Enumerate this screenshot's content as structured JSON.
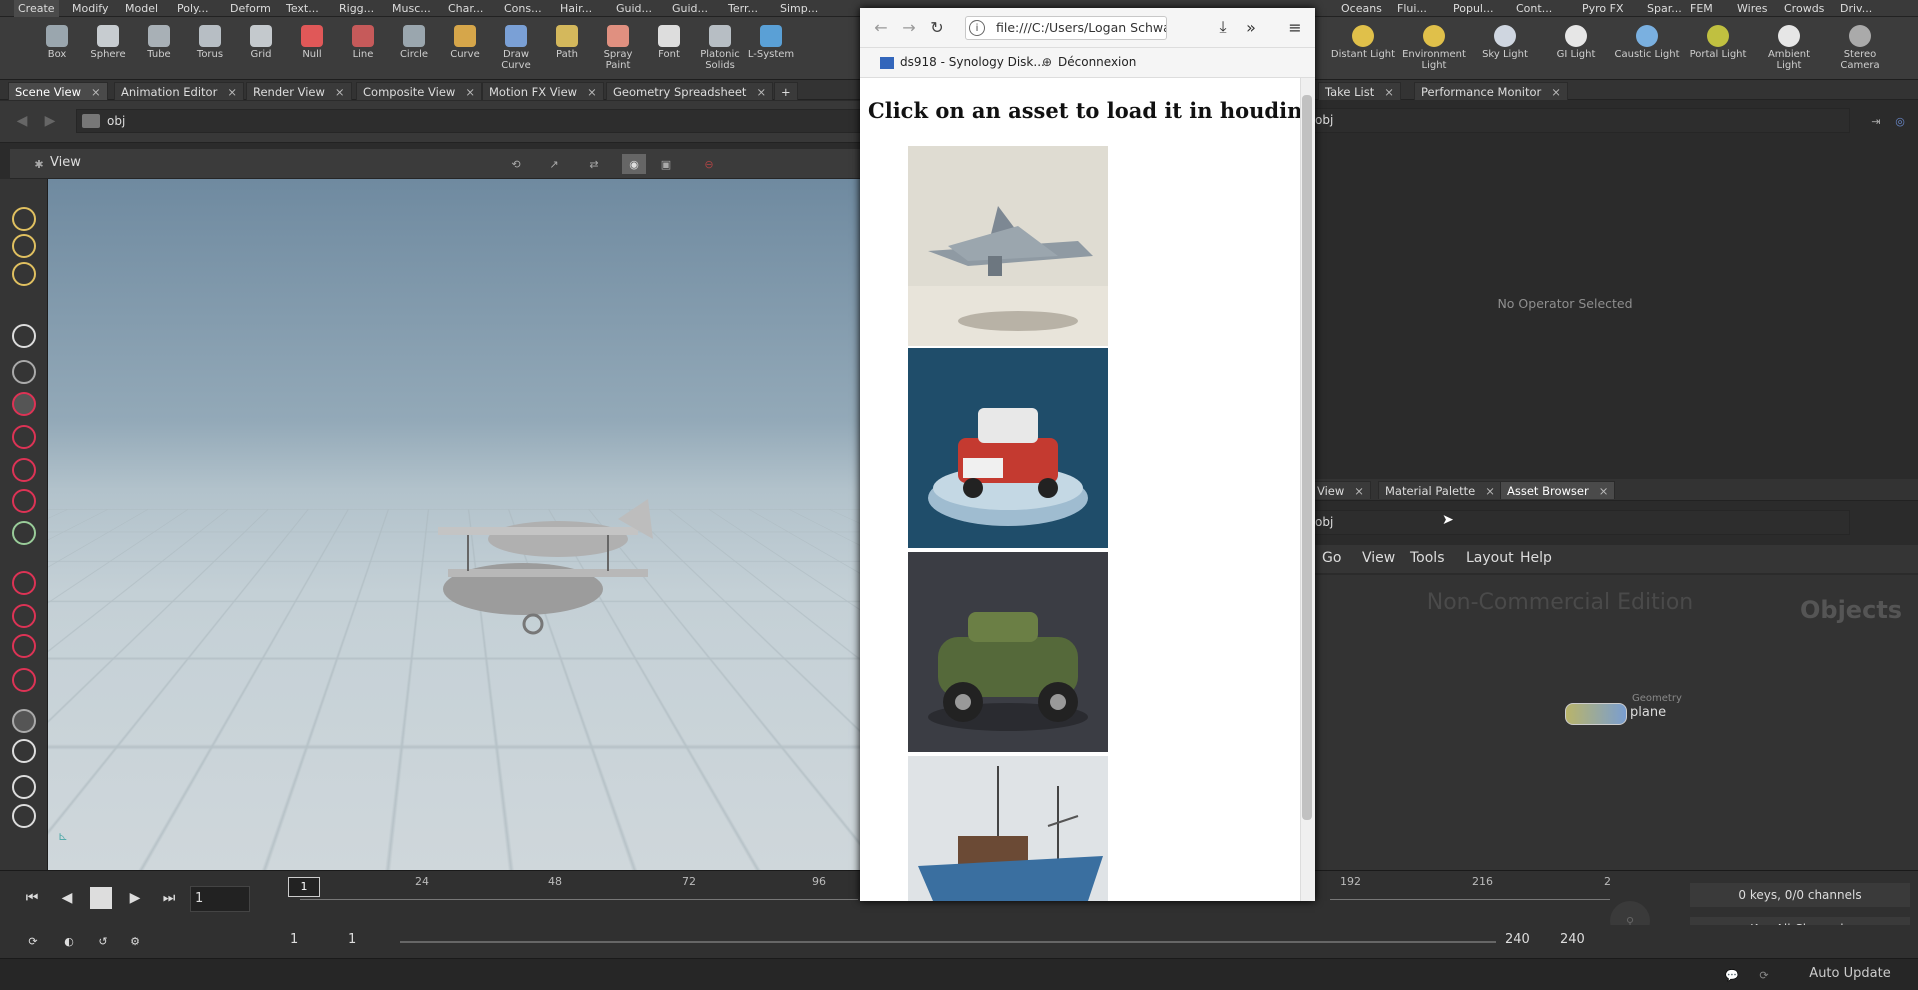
{
  "shelf_tabs": [
    "Create",
    "Modify",
    "Model",
    "Poly...",
    "Deform",
    "Text...",
    "Rigg...",
    "Musc...",
    "Char...",
    "Cons...",
    "Hair...",
    "Guid...",
    "Guid...",
    "Terr...",
    "Simp...",
    "Oceans",
    "Flui...",
    "Popul...",
    "Cont...",
    "Pyro FX",
    "Spar...",
    "FEM",
    "Wires",
    "Crowds",
    "Driv..."
  ],
  "tools_left": [
    {
      "label": "Box",
      "color": "#9aa6ae"
    },
    {
      "label": "Sphere",
      "color": "#c7ccd0"
    },
    {
      "label": "Tube",
      "color": "#a8b0b6"
    },
    {
      "label": "Torus",
      "color": "#b7bec4"
    },
    {
      "label": "Grid",
      "color": "#c4c9cd"
    },
    {
      "label": "Null",
      "color": "#e05858"
    },
    {
      "label": "Line",
      "color": "#c65a5a"
    },
    {
      "label": "Circle",
      "color": "#9aa6ae"
    },
    {
      "label": "Curve",
      "color": "#d6a64a"
    },
    {
      "label": "Draw Curve",
      "color": "#7aa0d6"
    },
    {
      "label": "Path",
      "color": "#d4b85c"
    },
    {
      "label": "Spray Paint",
      "color": "#e09080"
    },
    {
      "label": "Font",
      "color": "#dddddd"
    },
    {
      "label": "Platonic Solids",
      "color": "#b7bec4"
    },
    {
      "label": "L-System",
      "color": "#5aa0d6"
    }
  ],
  "tools_right": [
    {
      "label": "Distant Light",
      "color": "#e0c04a"
    },
    {
      "label": "Environment Light",
      "color": "#e0c04a"
    },
    {
      "label": "Sky Light",
      "color": "#cfd6e0"
    },
    {
      "label": "GI Light",
      "color": "#e6e6e6"
    },
    {
      "label": "Caustic Light",
      "color": "#7ab0e0"
    },
    {
      "label": "Portal Light",
      "color": "#c0c040"
    },
    {
      "label": "Ambient Light",
      "color": "#e6e6e6"
    },
    {
      "label": "Stereo Camera",
      "color": "#aaaaaa"
    }
  ],
  "pane_tabs": [
    "Scene View",
    "Animation Editor",
    "Render View",
    "Composite View",
    "Motion FX View",
    "Geometry Spreadsheet"
  ],
  "path": "obj",
  "view_label": "View",
  "browser": {
    "url": "file:///C:/Users/Logan Schwa",
    "bookmark1": "ds918 - Synology Disk...",
    "bookmark2": "Déconnexion",
    "heading": "Click on an asset to load it in houdini"
  },
  "right_tabs_top": [
    "Take List",
    "Performance Monitor"
  ],
  "right_path": "obj",
  "no_operator": "No Operator Selected",
  "right_bot_tabs": [
    "View",
    "Material Palette",
    "Asset Browser"
  ],
  "net_menu": [
    "Go",
    "View",
    "Tools",
    "Layout",
    "Help"
  ],
  "watermark": "Non-Commercial Edition",
  "objects_label": "Objects",
  "node": {
    "type": "Geometry",
    "name": "plane"
  },
  "timeline": {
    "frame": "1",
    "marker": "1",
    "ticks": [
      "24",
      "48",
      "72",
      "96",
      "192",
      "216",
      "2"
    ],
    "start": "1",
    "start2": "1",
    "end": "240",
    "end2": "240",
    "keys": "0 keys, 0/0 channels",
    "key_all": "Key All Channels"
  },
  "status": {
    "auto_update": "Auto Update"
  }
}
